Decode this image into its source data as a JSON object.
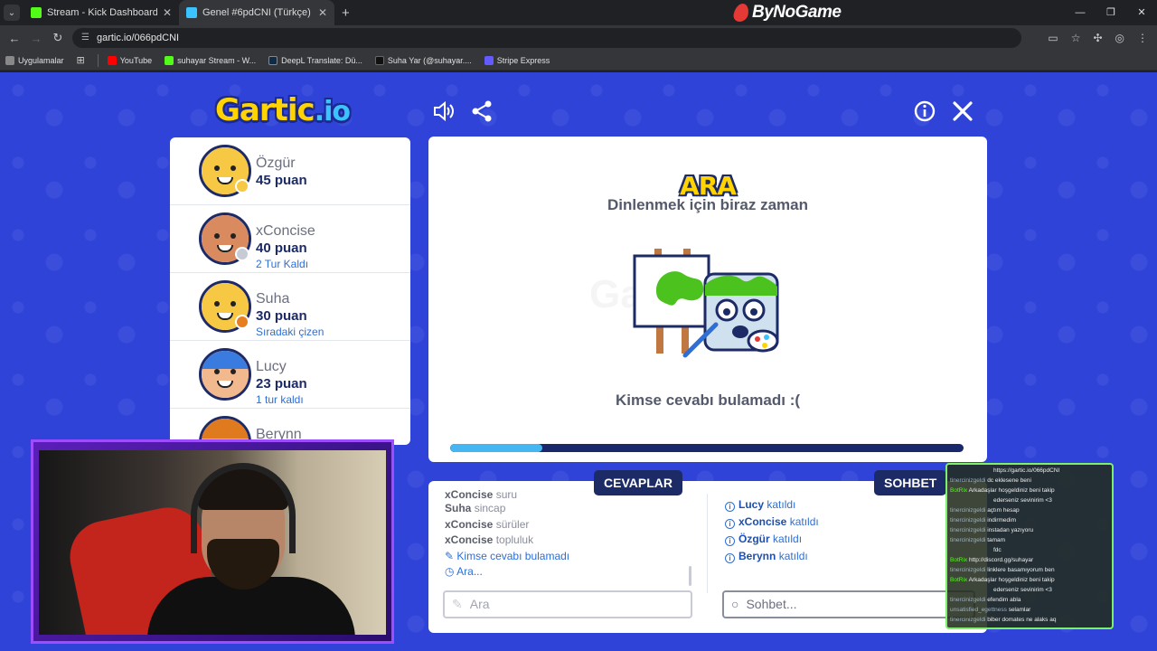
{
  "browser": {
    "tabs": [
      {
        "label": "Stream - Kick Dashboard",
        "fav_color": "#53fc18",
        "active": false
      },
      {
        "label": "Genel #6pdCNI (Türkçe) - Gartic",
        "fav_color": "#3ac3ff",
        "active": true
      }
    ],
    "brand": "ByNoGame",
    "url": "gartic.io/066pdCNI",
    "bookmarks": [
      {
        "label": "Uygulamalar",
        "color": "#888888"
      },
      {
        "label": "YouTube",
        "color": "#ff0000"
      },
      {
        "label": "suhayar Stream - W...",
        "color": "#53fc18"
      },
      {
        "label": "DeepL Translate: Dü...",
        "color": "#0f2b46"
      },
      {
        "label": "Suha Yar (@suhayar....",
        "color": "#111111"
      },
      {
        "label": "Stripe Express",
        "color": "#635bff"
      }
    ]
  },
  "game": {
    "logo": "Gartic",
    "logo_suffix": ".io",
    "players": [
      {
        "name": "Özgür",
        "score": "45 puan",
        "note": "",
        "skin": "#f7c843",
        "status_color": "#f7c843"
      },
      {
        "name": "xConcise",
        "score": "40 puan",
        "note": "2 Tur Kaldı",
        "skin": "#d98b5f",
        "status_color": "#c8cbd6"
      },
      {
        "name": "Suha",
        "score": "30 puan",
        "note": "Sıradaki çizen",
        "skin": "#f7c843",
        "status_color": "#e67e22"
      },
      {
        "name": "Lucy",
        "score": "23 puan",
        "note": "1 tur kaldı",
        "skin": "#f2b98f",
        "status_color": ""
      },
      {
        "name": "Berynn",
        "score": "",
        "note": "",
        "skin": "#f2a96a",
        "status_color": ""
      }
    ],
    "stage": {
      "title": "ARA",
      "subtitle": "Dinlenmek için biraz zaman",
      "result": "Kimse cevabı bulamadı :(",
      "progress": 0.18
    },
    "answers": {
      "label": "CEVAPLAR",
      "rows": [
        {
          "user": "xConcise",
          "text": "suru"
        },
        {
          "user": "Suha",
          "text": "sincap"
        },
        {
          "user": "xConcise",
          "text": "sürüler"
        },
        {
          "user": "xConcise",
          "text": "topluluk"
        }
      ],
      "system_rows": [
        "Kimse cevabı bulamadı",
        "Ara..."
      ],
      "input_placeholder": "Ara"
    },
    "chat": {
      "label": "SOHBET",
      "rows": [
        {
          "user": "Lucy",
          "text": "katıldı"
        },
        {
          "user": "xConcise",
          "text": "katıldı"
        },
        {
          "user": "Özgür",
          "text": "katıldı"
        },
        {
          "user": "Berynn",
          "text": "katıldı"
        }
      ],
      "input_placeholder": "Sohbet..."
    }
  },
  "stream_chat": [
    {
      "user": "",
      "text": "https://gartic.io/066pdCNI",
      "bot": false
    },
    {
      "user": "tinercinizgeldi",
      "text": "dc eklesene beni",
      "bot": false
    },
    {
      "user": "BotRix",
      "text": "Arkadaşlar hoşgeldiniz beni takip",
      "bot": true
    },
    {
      "user": "",
      "text": "ederseniz sevinirim <3",
      "bot": false
    },
    {
      "user": "tinercinizgeldi",
      "text": "açtım hesap",
      "bot": false
    },
    {
      "user": "tinercinizgeldi",
      "text": "indirmedim",
      "bot": false
    },
    {
      "user": "tinercinizgeldi",
      "text": "instadan yazıyoru",
      "bot": false
    },
    {
      "user": "tinercinizgeldi",
      "text": "tamam",
      "bot": false
    },
    {
      "user": "",
      "text": "fdc",
      "bot": false
    },
    {
      "user": "BotRix",
      "text": "http://discord.gg/suhayar",
      "bot": true
    },
    {
      "user": "tinercinizgeldi",
      "text": "linklere basamıyorum ben",
      "bot": false
    },
    {
      "user": "BotRix",
      "text": "Arkadaşlar hoşgeldiniz beni takip",
      "bot": true
    },
    {
      "user": "",
      "text": "ederseniz sevinirim <3",
      "bot": false
    },
    {
      "user": "tinercinizgeldi",
      "text": "efendim abla",
      "bot": false
    },
    {
      "user": "unsatisfied_egettness",
      "text": "selamlar",
      "bot": false
    },
    {
      "user": "tinercinizgeldi",
      "text": "biber domates ne alaks aq",
      "bot": false
    }
  ]
}
